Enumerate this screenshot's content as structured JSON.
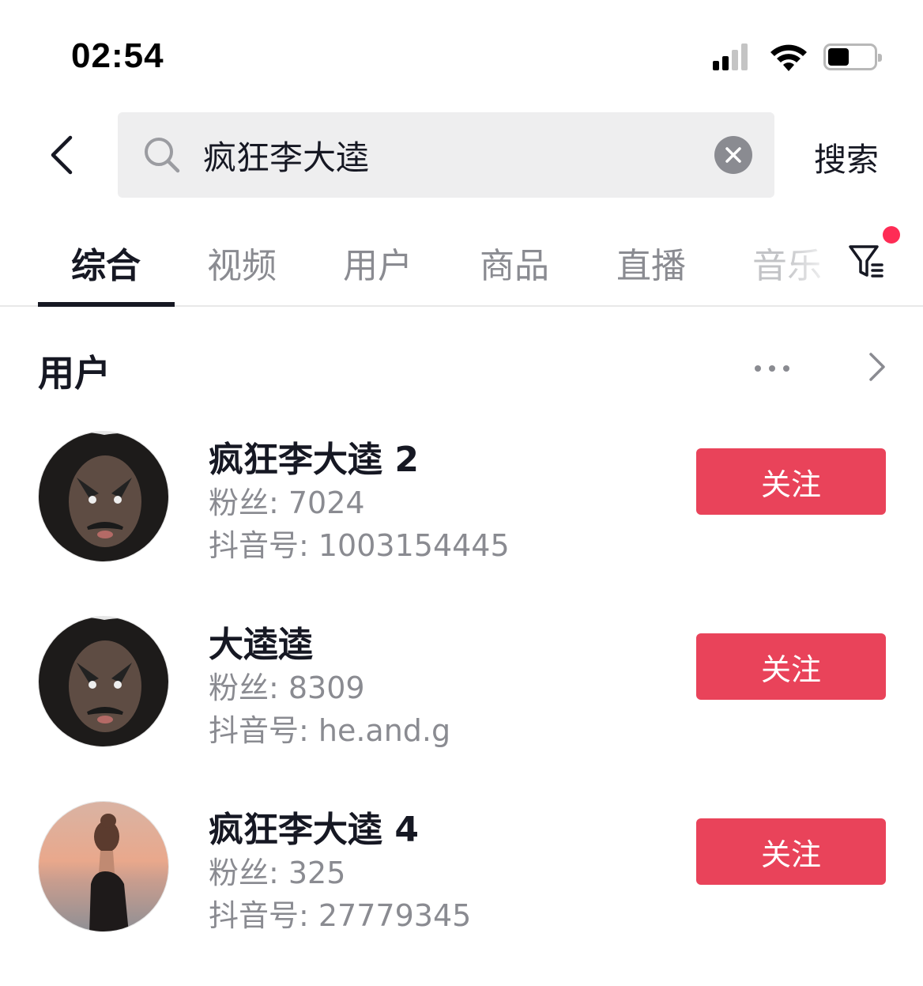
{
  "status_bar": {
    "time": "02:54",
    "signal_bars_active": 2,
    "signal_bars_total": 4,
    "battery_level": 0.4
  },
  "header": {
    "search_query": "疯狂李大逵",
    "search_button_label": "搜索"
  },
  "tabs": [
    {
      "label": "综合",
      "active": true
    },
    {
      "label": "视频",
      "active": false
    },
    {
      "label": "用户",
      "active": false
    },
    {
      "label": "商品",
      "active": false
    },
    {
      "label": "直播",
      "active": false
    },
    {
      "label": "音乐",
      "active": false
    }
  ],
  "section": {
    "title": "用户"
  },
  "users": [
    {
      "name": "疯狂李大逵 2",
      "fans": "粉丝: 7024",
      "douyin_id": "抖音号: 1003154445",
      "follow_label": "关注",
      "avatar": "man-face-painted-eyebrows"
    },
    {
      "name": "大逵逵",
      "fans": "粉丝: 8309",
      "douyin_id": "抖音号: he.and.g",
      "follow_label": "关注",
      "avatar": "man-face-painted-eyebrows"
    },
    {
      "name": "疯狂李大逵 4",
      "fans": "粉丝: 325",
      "douyin_id": "抖音号: 27779345",
      "follow_label": "关注",
      "avatar": "woman-sunset-sea"
    }
  ],
  "colors": {
    "accent": "#e9435a",
    "notification_dot": "#fe2c55",
    "text_primary": "#161823",
    "text_secondary": "#8a8b91",
    "search_bg": "#eeeeef"
  }
}
